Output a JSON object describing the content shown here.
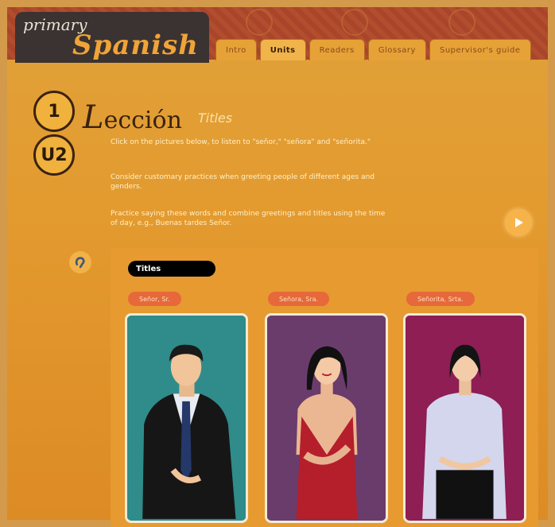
{
  "brand": {
    "small": "primary",
    "large": "Spanish"
  },
  "tabs": [
    {
      "label": "Intro",
      "active": false
    },
    {
      "label": "Units",
      "active": true
    },
    {
      "label": "Readers",
      "active": false
    },
    {
      "label": "Glossary",
      "active": false
    },
    {
      "label": "Supervisor's guide",
      "active": false
    }
  ],
  "lesson": {
    "number": "1",
    "unit": "U2",
    "heading": "ección",
    "heading_initial": "L",
    "subtitle": "Titles"
  },
  "instructions": [
    "Click on the pictures below, to listen to \"señor,\" \"señora\" and \"señorita.\"",
    "Consider customary practices when greeting people of different ages and genders.",
    "Practice saying these words and combine greetings and titles using the time of day, e.g., Buenas tardes Señor."
  ],
  "panel": {
    "title": "Titles",
    "people": [
      {
        "label": "Señor, Sr.",
        "bg": "#2f8c8a"
      },
      {
        "label": "Señora, Sra.",
        "bg": "#6a3c6c"
      },
      {
        "label": "Señorita, Srta.",
        "bg": "#8e1e54"
      }
    ]
  },
  "icons": {
    "play": "play-icon",
    "audio": "ear-icon"
  }
}
